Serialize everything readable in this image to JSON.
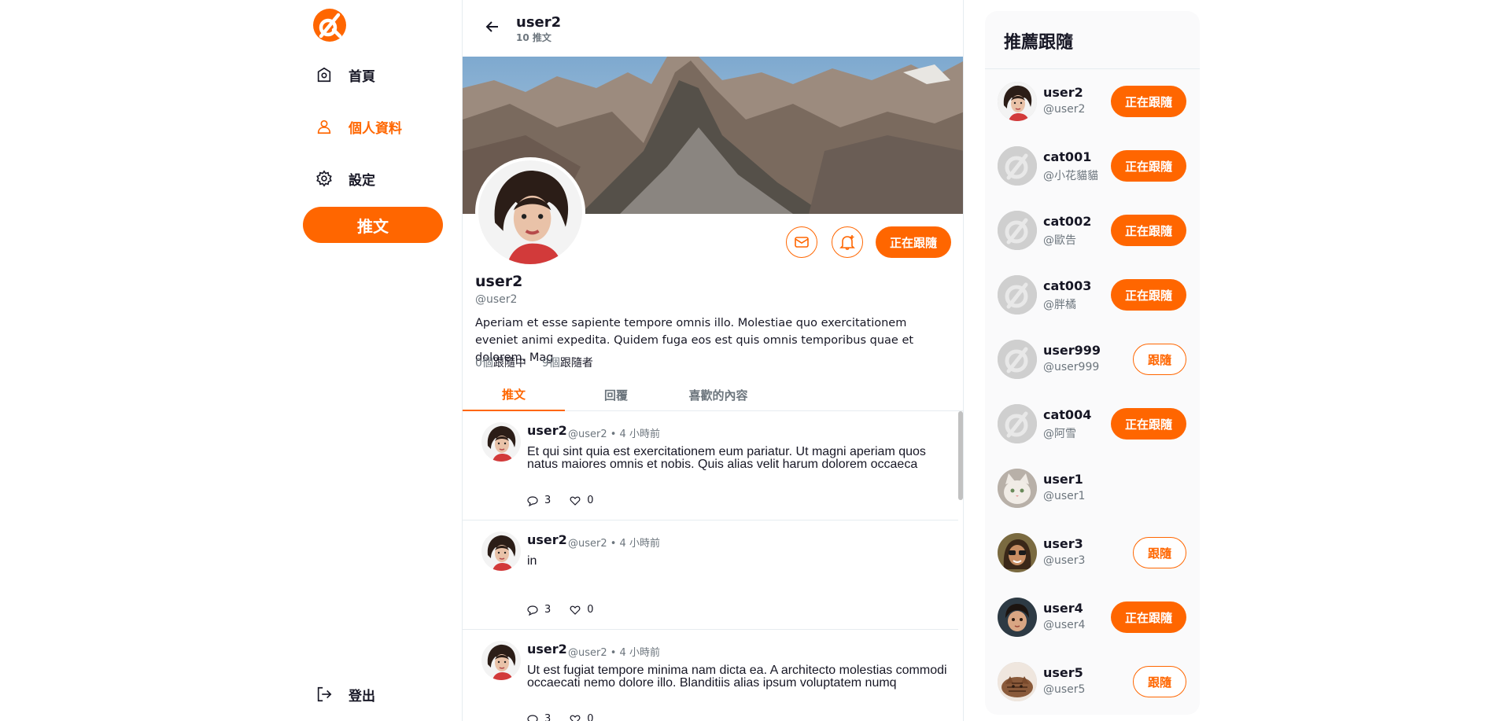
{
  "nav": {
    "home": "首頁",
    "profile": "個人資料",
    "settings": "設定",
    "tweet": "推文",
    "logout": "登出"
  },
  "header": {
    "title": "user2",
    "subtitle": "10 推文"
  },
  "profile": {
    "name": "user2",
    "handle": "@user2",
    "bio": "Aperiam et esse sapiente tempore omnis illo. Molestiae quo exercitationem eveniet animi expedita. Quidem fuga eos est quis omnis temporibus quae et dolorem. Mag",
    "following_count": "0個",
    "following_label": "跟隨中",
    "followers_count": "9個",
    "followers_label": "跟隨者",
    "follow_button": "正在跟隨"
  },
  "tabs": [
    "推文",
    "回覆",
    "喜歡的內容"
  ],
  "posts": [
    {
      "name": "user2",
      "meta": "@user2 • 4 小時前",
      "text": "Et qui sint quia est exercitationem eum pariatur. Ut magni aperiam quos natus maiores omnis et nobis. Quis alias velit harum dolorem occaeca",
      "replies": "3",
      "likes": "0"
    },
    {
      "name": "user2",
      "meta": "@user2 • 4 小時前",
      "text": "in",
      "replies": "3",
      "likes": "0"
    },
    {
      "name": "user2",
      "meta": "@user2 • 4 小時前",
      "text": "Ut est fugiat tempore minima nam dicta ea. A architecto molestias commodi occaecati nemo dolore illo. Blanditiis alias ipsum voluptatem numq",
      "replies": "3",
      "likes": "0"
    }
  ],
  "recommend": {
    "title": "推薦跟隨",
    "users": [
      {
        "name": "user2",
        "handle": "@user2",
        "button": "正在跟隨",
        "state": "following",
        "avatar": "woman"
      },
      {
        "name": "cat001",
        "handle": "@小花貓貓",
        "button": "正在跟隨",
        "state": "following",
        "avatar": "default"
      },
      {
        "name": "cat002",
        "handle": "@歐告",
        "button": "正在跟隨",
        "state": "following",
        "avatar": "default"
      },
      {
        "name": "cat003",
        "handle": "@胖橘",
        "button": "正在跟隨",
        "state": "following",
        "avatar": "default"
      },
      {
        "name": "user999",
        "handle": "@user999",
        "button": "跟隨",
        "state": "follow",
        "avatar": "default"
      },
      {
        "name": "cat004",
        "handle": "@阿雪",
        "button": "正在跟隨",
        "state": "following",
        "avatar": "default"
      },
      {
        "name": "user1",
        "handle": "@user1",
        "button": "",
        "state": "none",
        "avatar": "cat"
      },
      {
        "name": "user3",
        "handle": "@user3",
        "button": "跟隨",
        "state": "follow",
        "avatar": "sunglasses"
      },
      {
        "name": "user4",
        "handle": "@user4",
        "button": "正在跟隨",
        "state": "following",
        "avatar": "child"
      },
      {
        "name": "user5",
        "handle": "@user5",
        "button": "跟隨",
        "state": "follow",
        "avatar": "tabby"
      }
    ]
  },
  "colors": {
    "accent": "#ff6600",
    "muted": "#6c757d",
    "text": "#171725",
    "panel": "#fafafb"
  }
}
